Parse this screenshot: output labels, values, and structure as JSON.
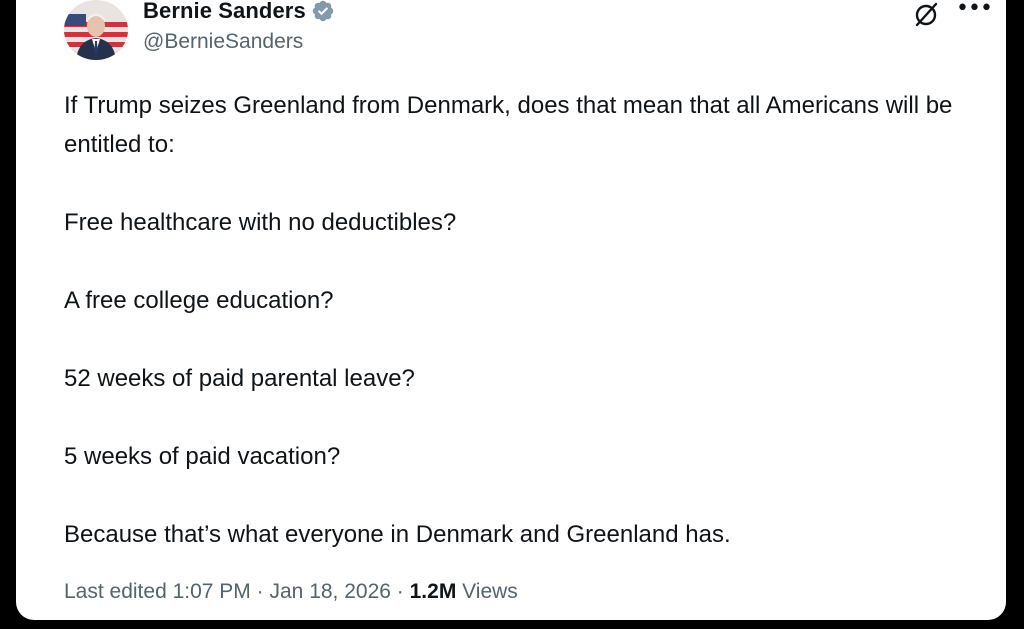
{
  "author": {
    "display_name": "Bernie Sanders",
    "handle": "@BernieSanders",
    "verified": true,
    "verified_color": "#829aab"
  },
  "tweet": {
    "paragraphs": [
      "If Trump seizes Greenland from Denmark, does that mean that all Americans will be entitled to:",
      "Free healthcare with no deductibles?",
      "A free college education?",
      "52 weeks of paid parental leave?",
      "5 weeks of paid vacation?",
      "Because that’s what everyone in Denmark and Greenland has."
    ]
  },
  "meta": {
    "edited_label": "Last edited",
    "time": "1:07 PM",
    "separator": "·",
    "date": "Jan 18, 2026",
    "views_count": "1.2M",
    "views_label": "Views"
  },
  "icons": {
    "grok": "grok-icon",
    "more": "more-options-icon",
    "verified": "verified-badge-icon"
  },
  "colors": {
    "text_primary": "#0f1419",
    "text_secondary": "#536471",
    "background": "#ffffff",
    "frame": "#000000"
  }
}
